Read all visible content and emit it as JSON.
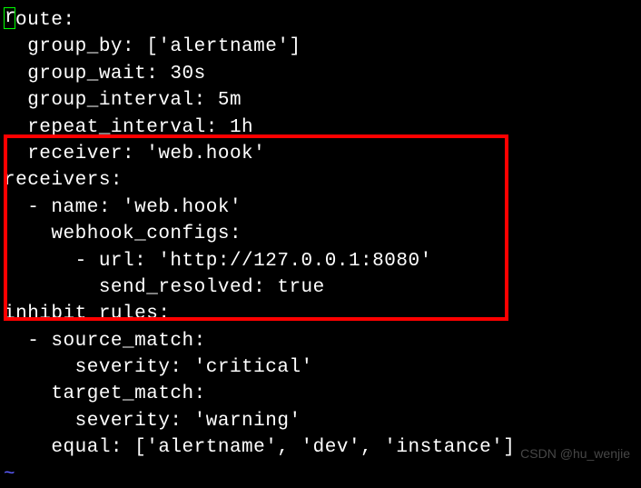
{
  "lines": {
    "l1a": "r",
    "l1b": "oute:",
    "l2": "  group_by: ['alertname']",
    "l3": "  group_wait: 30s",
    "l4": "  group_interval: 5m",
    "l5": "  repeat_interval: 1h",
    "l6": "  receiver: 'web.hook'",
    "l7": "receivers:",
    "l8": "  - name: 'web.hook'",
    "l9": "    webhook_configs:",
    "l10": "      - url: 'http://127.0.0.1:8080'",
    "l11": "        send_resolved: true",
    "l12": "inhibit_rules:",
    "l13": "  - source_match:",
    "l14": "      severity: 'critical'",
    "l15": "    target_match:",
    "l16": "      severity: 'warning'",
    "l17": "    equal: ['alertname', 'dev', 'instance']",
    "l18": "~"
  },
  "watermark": "CSDN @hu_wenjie"
}
